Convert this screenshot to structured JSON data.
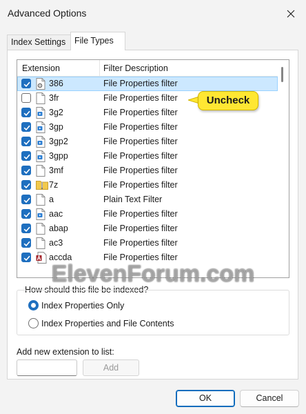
{
  "window": {
    "title": "Advanced Options"
  },
  "tabs": [
    {
      "label": "Index Settings",
      "active": false
    },
    {
      "label": "File Types",
      "active": true
    }
  ],
  "file_list": {
    "columns": [
      "Extension",
      "Filter Description"
    ],
    "rows": [
      {
        "ext": "386",
        "desc": "File Properties filter",
        "checked": true,
        "icon": "gear-file-icon",
        "selected": true
      },
      {
        "ext": "3fr",
        "desc": "File Properties filter",
        "checked": false,
        "icon": "blank-file-icon",
        "selected": false
      },
      {
        "ext": "3g2",
        "desc": "File Properties filter",
        "checked": true,
        "icon": "media-file-icon",
        "selected": false
      },
      {
        "ext": "3gp",
        "desc": "File Properties filter",
        "checked": true,
        "icon": "media-file-icon",
        "selected": false
      },
      {
        "ext": "3gp2",
        "desc": "File Properties filter",
        "checked": true,
        "icon": "media-file-icon",
        "selected": false
      },
      {
        "ext": "3gpp",
        "desc": "File Properties filter",
        "checked": true,
        "icon": "media-file-icon",
        "selected": false
      },
      {
        "ext": "3mf",
        "desc": "File Properties filter",
        "checked": true,
        "icon": "blank-file-icon",
        "selected": false
      },
      {
        "ext": "7z",
        "desc": "File Properties filter",
        "checked": true,
        "icon": "zip-folder-icon",
        "selected": false
      },
      {
        "ext": "a",
        "desc": "Plain Text Filter",
        "checked": true,
        "icon": "blank-file-icon",
        "selected": false
      },
      {
        "ext": "aac",
        "desc": "File Properties filter",
        "checked": true,
        "icon": "media-file-icon",
        "selected": false
      },
      {
        "ext": "abap",
        "desc": "File Properties filter",
        "checked": true,
        "icon": "blank-file-icon",
        "selected": false
      },
      {
        "ext": "ac3",
        "desc": "File Properties filter",
        "checked": true,
        "icon": "blank-file-icon",
        "selected": false
      },
      {
        "ext": "accda",
        "desc": "File Properties filter",
        "checked": true,
        "icon": "access-file-icon",
        "selected": false
      }
    ]
  },
  "callout": {
    "text": "Uncheck",
    "color": "#ffe733"
  },
  "watermark": {
    "text": "ElevenForum.com"
  },
  "index_group": {
    "label": "How should this file be indexed?",
    "options": [
      {
        "label": "Index Properties Only",
        "selected": true
      },
      {
        "label": "Index Properties and File Contents",
        "selected": false
      }
    ]
  },
  "add_extension": {
    "label": "Add new extension to list:",
    "value": "",
    "button_label": "Add"
  },
  "buttons": {
    "ok": "OK",
    "cancel": "Cancel"
  },
  "colors": {
    "accent": "#1e6fbf",
    "selection": "#cce8ff",
    "callout": "#ffe733"
  }
}
